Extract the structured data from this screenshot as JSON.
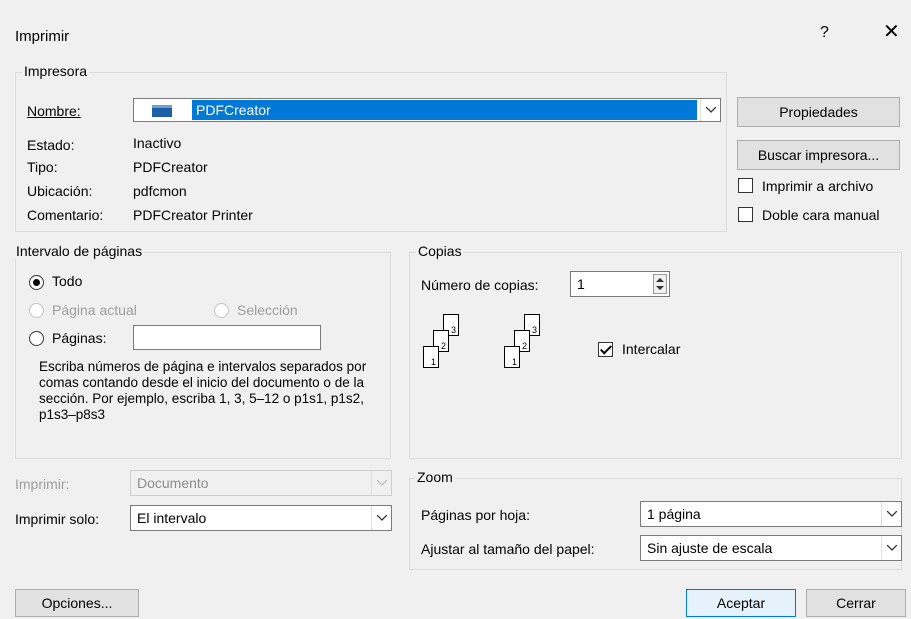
{
  "dialog": {
    "title": "Imprimir",
    "help": "?",
    "close": "✕"
  },
  "printer": {
    "group_label": "Impresora",
    "name_label": "Nombre:",
    "name_value": "PDFCreator",
    "status_label": "Estado:",
    "status_value": "Inactivo",
    "type_label": "Tipo:",
    "type_value": "PDFCreator",
    "location_label": "Ubicación:",
    "location_value": "pdfcmon",
    "comment_label": "Comentario:",
    "comment_value": "PDFCreator Printer",
    "properties_button": "Propiedades",
    "find_printer_button": "Buscar impresora...",
    "print_to_file_label": "Imprimir a archivo",
    "manual_duplex_label": "Doble cara manual",
    "print_to_file_checked": false,
    "manual_duplex_checked": false
  },
  "page_range": {
    "group_label": "Intervalo de páginas",
    "all_label": "Todo",
    "current_page_label": "Página actual",
    "selection_label": "Selección",
    "pages_label": "Páginas:",
    "pages_value": "",
    "description": "Escriba números de página e intervalos separados por comas contando desde el inicio del documento o de la sección. Por ejemplo, escriba 1, 3, 5–12 o p1s1, p1s2, p1s3–p8s3"
  },
  "copies": {
    "group_label": "Copias",
    "count_label": "Número de copias:",
    "count_value": "1",
    "collate_label": "Intercalar",
    "collate_checked": true,
    "page_numbers": [
      "1",
      "2",
      "3"
    ]
  },
  "print_what": {
    "label": "Imprimir:",
    "value": "Documento"
  },
  "print_only": {
    "label": "Imprimir solo:",
    "value": "El intervalo"
  },
  "zoom": {
    "group_label": "Zoom",
    "pages_per_sheet_label": "Páginas por hoja:",
    "pages_per_sheet_value": "1 página",
    "scale_label": "Ajustar al tamaño del papel:",
    "scale_value": "Sin ajuste de escala"
  },
  "footer": {
    "options_button": "Opciones...",
    "ok_button": "Aceptar",
    "cancel_button": "Cerrar"
  }
}
